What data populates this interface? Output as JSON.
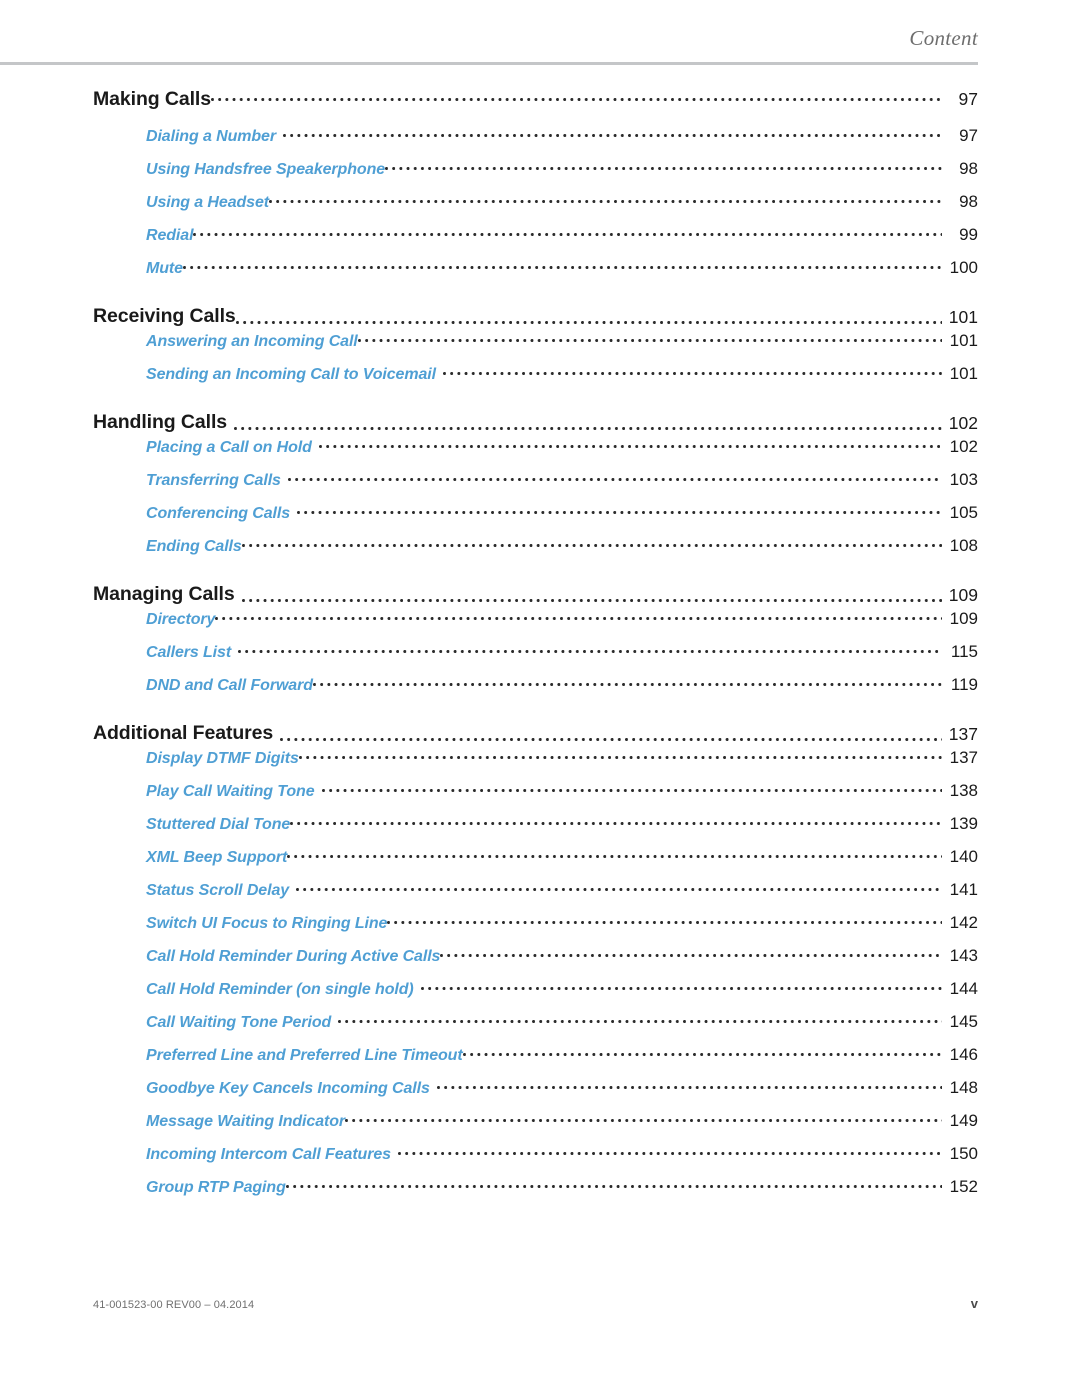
{
  "header": {
    "title": "Content"
  },
  "toc": {
    "entries": [
      {
        "label": "Making Calls",
        "page": "97",
        "level": 1,
        "gap": false,
        "leader": "tight"
      },
      {
        "label": "Dialing a Number",
        "page": "97",
        "level": 2,
        "leader": "loose"
      },
      {
        "label": "Using Handsfree Speakerphone",
        "page": "98",
        "level": 2,
        "leader": "tight"
      },
      {
        "label": "Using a Headset",
        "page": "98",
        "level": 2,
        "leader": "tight"
      },
      {
        "label": "Redial",
        "page": "99",
        "level": 2,
        "leader": "tight"
      },
      {
        "label": "Mute",
        "page": "100",
        "level": 2,
        "leader": "tight"
      },
      {
        "label": "Receiving Calls",
        "page": "101",
        "level": 1,
        "gap": true,
        "leader": "tight"
      },
      {
        "label": "Answering an Incoming Call",
        "page": "101",
        "level": 2,
        "leader": "tight"
      },
      {
        "label": "Sending an Incoming Call to Voicemail",
        "page": "101",
        "level": 2,
        "leader": "loose"
      },
      {
        "label": "Handling Calls",
        "page": "102",
        "level": 1,
        "gap": true,
        "leader": "loose"
      },
      {
        "label": "Placing a Call on Hold",
        "page": "102",
        "level": 2,
        "leader": "loose"
      },
      {
        "label": "Transferring Calls",
        "page": "103",
        "level": 2,
        "leader": "loose"
      },
      {
        "label": "Conferencing Calls",
        "page": "105",
        "level": 2,
        "leader": "loose"
      },
      {
        "label": "Ending Calls",
        "page": "108",
        "level": 2,
        "leader": "tight"
      },
      {
        "label": "Managing Calls",
        "page": "109",
        "level": 1,
        "gap": true,
        "leader": "loose"
      },
      {
        "label": "Directory",
        "page": "109",
        "level": 2,
        "leader": "tight"
      },
      {
        "label": "Callers List",
        "page": "115",
        "level": 2,
        "leader": "loose"
      },
      {
        "label": "DND and Call Forward",
        "page": "119",
        "level": 2,
        "leader": "tight"
      },
      {
        "label": "Additional Features",
        "page": "137",
        "level": 1,
        "gap": true,
        "leader": "loose"
      },
      {
        "label": "Display DTMF Digits",
        "page": "137",
        "level": 2,
        "leader": "tight"
      },
      {
        "label": "Play Call Waiting Tone",
        "page": "138",
        "level": 2,
        "leader": "loose"
      },
      {
        "label": "Stuttered Dial Tone",
        "page": "139",
        "level": 2,
        "leader": "tight"
      },
      {
        "label": "XML Beep Support",
        "page": "140",
        "level": 2,
        "leader": "tight"
      },
      {
        "label": "Status Scroll Delay",
        "page": "141",
        "level": 2,
        "leader": "loose"
      },
      {
        "label": "Switch UI Focus to Ringing Line",
        "page": "142",
        "level": 2,
        "leader": "tight"
      },
      {
        "label": "Call Hold Reminder During Active Calls",
        "page": "143",
        "level": 2,
        "leader": "tight"
      },
      {
        "label": "Call Hold Reminder (on single hold)",
        "page": "144",
        "level": 2,
        "leader": "loose"
      },
      {
        "label": "Call Waiting Tone Period",
        "page": "145",
        "level": 2,
        "leader": "loose"
      },
      {
        "label": "Preferred Line and Preferred Line Timeout",
        "page": "146",
        "level": 2,
        "leader": "tight"
      },
      {
        "label": "Goodbye Key Cancels Incoming Calls",
        "page": "148",
        "level": 2,
        "leader": "loose"
      },
      {
        "label": "Message Waiting Indicator",
        "page": "149",
        "level": 2,
        "leader": "tight"
      },
      {
        "label": "Incoming Intercom Call Features",
        "page": "150",
        "level": 2,
        "leader": "loose"
      },
      {
        "label": "Group RTP Paging",
        "page": "152",
        "level": 2,
        "leader": "tight"
      }
    ]
  },
  "footer": {
    "document_id": "41-001523-00 REV00 – 04.2014",
    "page_number": "v"
  },
  "colors": {
    "subentry_blue": "#4f9fd4",
    "heading_black": "#1a1a1a",
    "rule_gray": "#c4c6c8",
    "header_gray": "#6e6e6e"
  }
}
